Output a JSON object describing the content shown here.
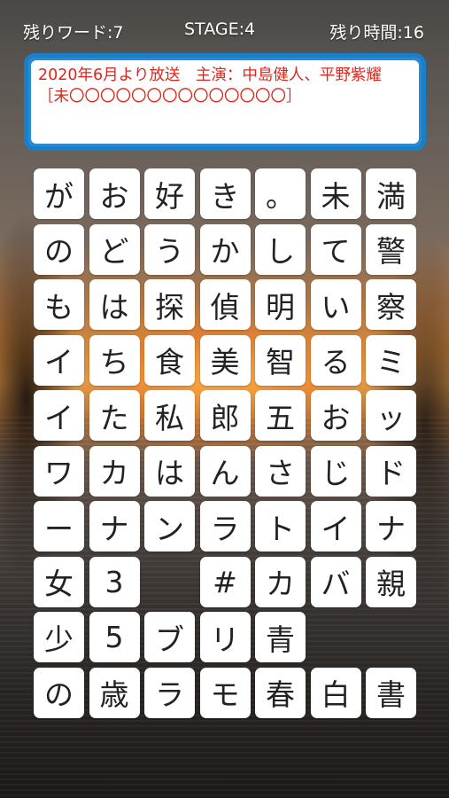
{
  "hud": {
    "remaining_words": "残りワード:7",
    "stage": "STAGE:4",
    "remaining_time": "残り時間:16"
  },
  "hint": {
    "text": "2020年6月より放送　主演：中島健人、平野紫耀［未〇〇〇〇〇〇〇〇〇〇〇〇〇〇］"
  },
  "board": {
    "rows": [
      [
        "が",
        "お",
        "好",
        "き",
        "。",
        "未",
        "満"
      ],
      [
        "の",
        "ど",
        "う",
        "か",
        "し",
        "て",
        "警"
      ],
      [
        "も",
        "は",
        "探",
        "偵",
        "明",
        "い",
        "察"
      ],
      [
        "イ",
        "ち",
        "食",
        "美",
        "智",
        "る",
        "ミ"
      ],
      [
        "イ",
        "た",
        "私",
        "郎",
        "五",
        "お",
        "ッ"
      ],
      [
        "ワ",
        "カ",
        "は",
        "ん",
        "さ",
        "じ",
        "ド"
      ],
      [
        "ー",
        "ナ",
        "ン",
        "ラ",
        "ト",
        "イ",
        "ナ"
      ],
      [
        "女",
        "3",
        "",
        "#",
        "カ",
        "バ",
        "親"
      ],
      [
        "少",
        "5",
        "ブ",
        "リ",
        "青",
        "",
        ""
      ],
      [
        "の",
        "歳",
        "ラ",
        "モ",
        "春",
        "白",
        "書"
      ]
    ]
  }
}
